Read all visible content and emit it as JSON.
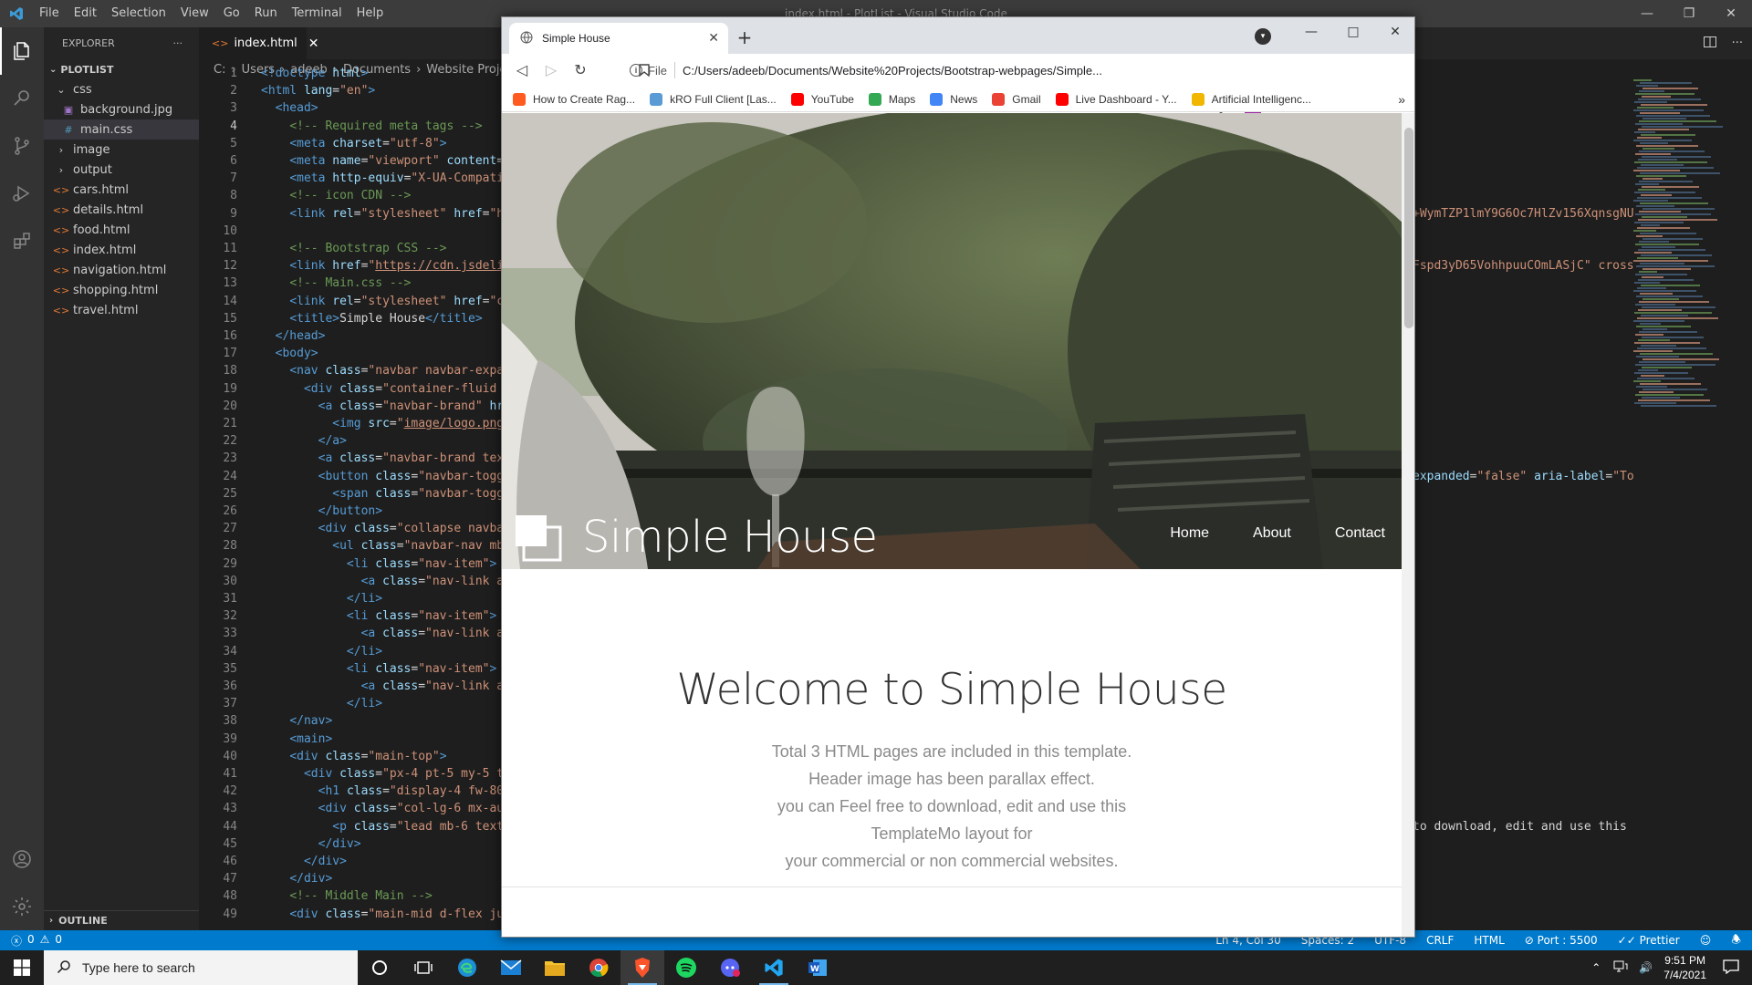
{
  "vscode": {
    "menu": [
      "File",
      "Edit",
      "Selection",
      "View",
      "Go",
      "Run",
      "Terminal",
      "Help"
    ],
    "window_title": "index.html - PlotList - Visual Studio Code",
    "explorer": {
      "header": "EXPLORER",
      "project": "PLOTLIST",
      "items": [
        {
          "label": "css",
          "type": "folder-open",
          "indent": 1
        },
        {
          "label": "background.jpg",
          "type": "image",
          "indent": 2
        },
        {
          "label": "main.css",
          "type": "css",
          "indent": 2,
          "selected": true
        },
        {
          "label": "image",
          "type": "folder",
          "indent": 1
        },
        {
          "label": "output",
          "type": "folder",
          "indent": 1
        },
        {
          "label": "cars.html",
          "type": "html",
          "indent": 1
        },
        {
          "label": "details.html",
          "type": "html",
          "indent": 1
        },
        {
          "label": "food.html",
          "type": "html",
          "indent": 1
        },
        {
          "label": "index.html",
          "type": "html",
          "indent": 1
        },
        {
          "label": "navigation.html",
          "type": "html",
          "indent": 1
        },
        {
          "label": "shopping.html",
          "type": "html",
          "indent": 1
        },
        {
          "label": "travel.html",
          "type": "html",
          "indent": 1
        }
      ],
      "outline": "OUTLINE"
    },
    "tab": {
      "label": "index.html"
    },
    "breadcrumb": [
      "C:",
      "Users",
      "adeeb",
      "Documents",
      "Website Projects"
    ],
    "current_line": 4,
    "code_lines": [
      {
        "n": 1,
        "html": "<span class='t-tag'>&lt;!doctype</span> <span class='t-attr'>html</span><span class='t-tag'>&gt;</span>"
      },
      {
        "n": 2,
        "html": "<span class='t-tag'>&lt;html</span> <span class='t-attr'>lang</span>=<span class='t-str'>\"en\"</span><span class='t-tag'>&gt;</span>"
      },
      {
        "n": 3,
        "html": "  <span class='t-tag'>&lt;head&gt;</span>"
      },
      {
        "n": 4,
        "html": "    <span class='t-com'>&lt;!-- Required meta tags --&gt;</span>"
      },
      {
        "n": 5,
        "html": "    <span class='t-tag'>&lt;meta</span> <span class='t-attr'>charset</span>=<span class='t-str'>\"utf-8\"</span><span class='t-tag'>&gt;</span>"
      },
      {
        "n": 6,
        "html": "    <span class='t-tag'>&lt;meta</span> <span class='t-attr'>name</span>=<span class='t-str'>\"viewport\"</span> <span class='t-attr'>content</span>="
      },
      {
        "n": 7,
        "html": "    <span class='t-tag'>&lt;meta</span> <span class='t-attr'>http-equiv</span>=<span class='t-str'>\"X-UA-Compati</span>"
      },
      {
        "n": 8,
        "html": "    <span class='t-com'>&lt;!-- icon CDN --&gt;</span>"
      },
      {
        "n": 9,
        "html": "    <span class='t-tag'>&lt;link</span> <span class='t-attr'>rel</span>=<span class='t-str'>\"stylesheet\"</span> <span class='t-attr'>href</span>=<span class='t-str'>\"h</span>"
      },
      {
        "n": 10,
        "html": ""
      },
      {
        "n": 11,
        "html": "    <span class='t-com'>&lt;!-- Bootstrap CSS --&gt;</span>"
      },
      {
        "n": 12,
        "html": "    <span class='t-tag'>&lt;link</span> <span class='t-attr'>href</span>=<span class='t-str'>\"<span class='t-ul'>https://cdn.jsdeli</span></span>"
      },
      {
        "n": 13,
        "html": "    <span class='t-com'>&lt;!-- Main.css --&gt;</span>"
      },
      {
        "n": 14,
        "html": "    <span class='t-tag'>&lt;link</span> <span class='t-attr'>rel</span>=<span class='t-str'>\"stylesheet\"</span> <span class='t-attr'>href</span>=<span class='t-str'>\"c</span>"
      },
      {
        "n": 15,
        "html": "    <span class='t-tag'>&lt;title&gt;</span>Simple House<span class='t-tag'>&lt;/title&gt;</span>"
      },
      {
        "n": 16,
        "html": "  <span class='t-tag'>&lt;/head&gt;</span>"
      },
      {
        "n": 17,
        "html": "  <span class='t-tag'>&lt;body&gt;</span>"
      },
      {
        "n": 18,
        "html": "    <span class='t-tag'>&lt;nav</span> <span class='t-attr'>class</span>=<span class='t-str'>\"navbar navbar-expa</span>"
      },
      {
        "n": 19,
        "html": "      <span class='t-tag'>&lt;div</span> <span class='t-attr'>class</span>=<span class='t-str'>\"container-fluid </span>"
      },
      {
        "n": 20,
        "html": "        <span class='t-tag'>&lt;a</span> <span class='t-attr'>class</span>=<span class='t-str'>\"navbar-brand\"</span> <span class='t-attr'>hr</span>"
      },
      {
        "n": 21,
        "html": "          <span class='t-tag'>&lt;img</span> <span class='t-attr'>src</span>=<span class='t-str'>\"<span class='t-ul'>image/logo.png</span></span>"
      },
      {
        "n": 22,
        "html": "        <span class='t-tag'>&lt;/a&gt;</span>"
      },
      {
        "n": 23,
        "html": "        <span class='t-tag'>&lt;a</span> <span class='t-attr'>class</span>=<span class='t-str'>\"navbar-brand tex</span>"
      },
      {
        "n": 24,
        "html": "        <span class='t-tag'>&lt;button</span> <span class='t-attr'>class</span>=<span class='t-str'>\"navbar-togg</span>"
      },
      {
        "n": 25,
        "html": "          <span class='t-tag'>&lt;span</span> <span class='t-attr'>class</span>=<span class='t-str'>\"navbar-togg</span>"
      },
      {
        "n": 26,
        "html": "        <span class='t-tag'>&lt;/button&gt;</span>"
      },
      {
        "n": 27,
        "html": "        <span class='t-tag'>&lt;div</span> <span class='t-attr'>class</span>=<span class='t-str'>\"collapse navba</span>"
      },
      {
        "n": 28,
        "html": "          <span class='t-tag'>&lt;ul</span> <span class='t-attr'>class</span>=<span class='t-str'>\"navbar-nav mb</span>"
      },
      {
        "n": 29,
        "html": "            <span class='t-tag'>&lt;li</span> <span class='t-attr'>class</span>=<span class='t-str'>\"nav-item\"</span><span class='t-tag'>&gt;</span>"
      },
      {
        "n": 30,
        "html": "              <span class='t-tag'>&lt;a</span> <span class='t-attr'>class</span>=<span class='t-str'>\"nav-link a</span>"
      },
      {
        "n": 31,
        "html": "            <span class='t-tag'>&lt;/li&gt;</span>"
      },
      {
        "n": 32,
        "html": "            <span class='t-tag'>&lt;li</span> <span class='t-attr'>class</span>=<span class='t-str'>\"nav-item\"</span><span class='t-tag'>&gt;</span>"
      },
      {
        "n": 33,
        "html": "              <span class='t-tag'>&lt;a</span> <span class='t-attr'>class</span>=<span class='t-str'>\"nav-link a</span>"
      },
      {
        "n": 34,
        "html": "            <span class='t-tag'>&lt;/li&gt;</span>"
      },
      {
        "n": 35,
        "html": "            <span class='t-tag'>&lt;li</span> <span class='t-attr'>class</span>=<span class='t-str'>\"nav-item\"</span><span class='t-tag'>&gt;</span>"
      },
      {
        "n": 36,
        "html": "              <span class='t-tag'>&lt;a</span> <span class='t-attr'>class</span>=<span class='t-str'>\"nav-link a</span>"
      },
      {
        "n": 37,
        "html": "            <span class='t-tag'>&lt;/li&gt;</span>"
      },
      {
        "n": 38,
        "html": "    <span class='t-tag'>&lt;/nav&gt;</span>"
      },
      {
        "n": 39,
        "html": "    <span class='t-tag'>&lt;main&gt;</span>"
      },
      {
        "n": 40,
        "html": "    <span class='t-tag'>&lt;div</span> <span class='t-attr'>class</span>=<span class='t-str'>\"main-top\"</span><span class='t-tag'>&gt;</span>"
      },
      {
        "n": 41,
        "html": "      <span class='t-tag'>&lt;div</span> <span class='t-attr'>class</span>=<span class='t-str'>\"px-4 pt-5 my-5 t</span>"
      },
      {
        "n": 42,
        "html": "        <span class='t-tag'>&lt;h1</span> <span class='t-attr'>class</span>=<span class='t-str'>\"display-4 fw-80</span>"
      },
      {
        "n": 43,
        "html": "        <span class='t-tag'>&lt;div</span> <span class='t-attr'>class</span>=<span class='t-str'>\"col-lg-6 mx-au</span>"
      },
      {
        "n": 44,
        "html": "          <span class='t-tag'>&lt;p</span> <span class='t-attr'>class</span>=<span class='t-str'>\"lead mb-6 text</span>"
      },
      {
        "n": 45,
        "html": "        <span class='t-tag'>&lt;/div&gt;</span>"
      },
      {
        "n": 46,
        "html": "      <span class='t-tag'>&lt;/div&gt;</span>"
      },
      {
        "n": 47,
        "html": "    <span class='t-tag'>&lt;/div&gt;</span>"
      },
      {
        "n": 48,
        "html": "    <span class='t-com'>&lt;!-- Middle Main --&gt;</span>"
      },
      {
        "n": 49,
        "html": "    <span class='t-tag'>&lt;div</span> <span class='t-attr'>class</span>=<span class='t-str'>\"main-mid d-flex ju</span>"
      }
    ],
    "overflow_text": [
      {
        "line": 9,
        "text": "+WymTZP1lmY9G6Oc7HlZv156XqnsgNU",
        "cls": "t-str"
      },
      {
        "line": 12,
        "text": "Fspd3yD65VohhpuuCOmLASjC\" cross",
        "cls": "t-str"
      },
      {
        "line": 24,
        "html": "<span class='t-attr'>expanded</span>=<span class='t-str'>\"false\"</span> <span class='t-attr'>aria-label</span>=<span class='t-str'>\"To</span>"
      },
      {
        "line": 44,
        "text": "to download, edit and use this",
        "cls": "t-txt"
      }
    ],
    "status": {
      "errors": "0",
      "warnings": "0",
      "position": "Ln 4, Col 30",
      "spaces": "Spaces: 2",
      "encoding": "UTF-8",
      "eol": "CRLF",
      "language": "HTML",
      "port": "Port : 5500",
      "prettier": "Prettier"
    }
  },
  "browser": {
    "tab_title": "Simple House",
    "url_scheme": "File",
    "url": "C:/Users/adeeb/Documents/Website%20Projects/Bootstrap-webpages/Simple...",
    "bookmarks": [
      {
        "label": "How to Create Rag...",
        "color": "#ff5a1f"
      },
      {
        "label": "kRO Full Client [Las...",
        "color": "#5b9bd5"
      },
      {
        "label": "YouTube",
        "color": "#ff0000"
      },
      {
        "label": "Maps",
        "color": "#34a853"
      },
      {
        "label": "News",
        "color": "#4285f4"
      },
      {
        "label": "Gmail",
        "color": "#ea4335"
      },
      {
        "label": "Live Dashboard - Y...",
        "color": "#ff0000"
      },
      {
        "label": "Artificial Intelligenc...",
        "color": "#f2b600"
      }
    ],
    "site": {
      "brand": "Simple House",
      "nav": [
        "Home",
        "About",
        "Contact"
      ],
      "heading": "Welcome to Simple House",
      "lead_lines": [
        "Total 3 HTML pages are included in this template.",
        "Header image has been parallax effect.",
        "you can Feel free to download, edit and use this",
        "TemplateMo layout for",
        "your commercial or non commercial websites."
      ],
      "accent": "#2d8c9c"
    }
  },
  "taskbar": {
    "search_placeholder": "Type here to search",
    "time": "9:51 PM",
    "date": "7/4/2021"
  }
}
